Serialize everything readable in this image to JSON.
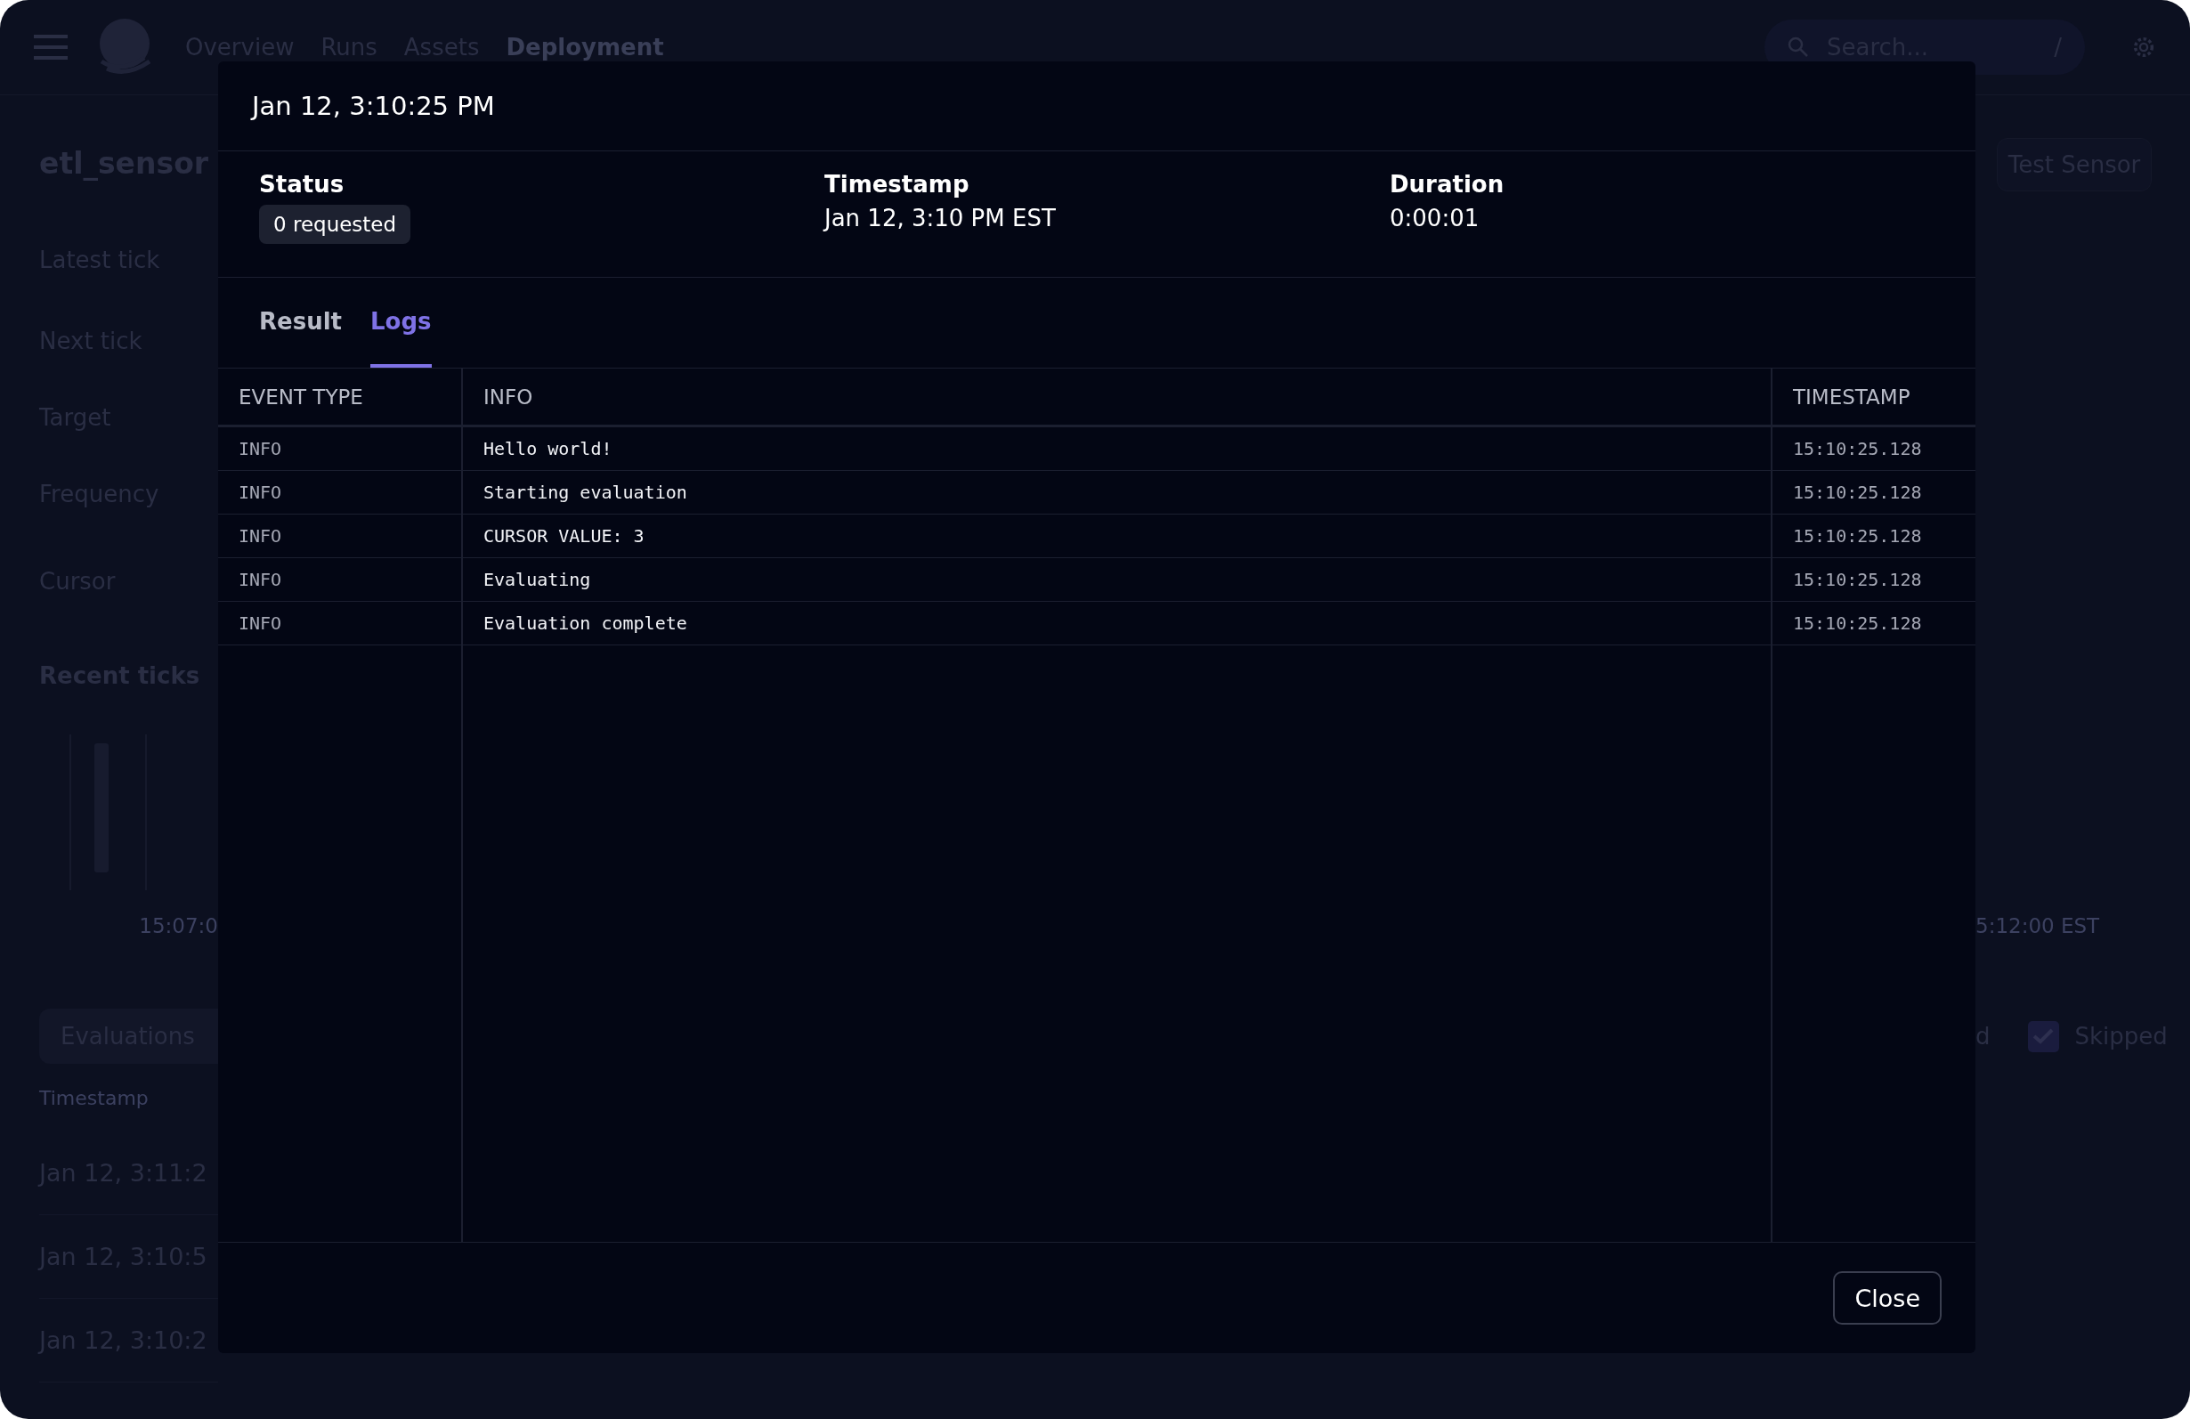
{
  "nav": {
    "links": [
      {
        "label": "Overview",
        "selected": false
      },
      {
        "label": "Runs",
        "selected": false
      },
      {
        "label": "Assets",
        "selected": false
      },
      {
        "label": "Deployment",
        "selected": true
      }
    ],
    "search": {
      "placeholder": "Search...",
      "shortcut": "/"
    }
  },
  "page": {
    "title": "etl_sensor",
    "test_button": "Test Sensor",
    "details": [
      "Latest tick",
      "Next tick",
      "Target",
      "Frequency",
      "Cursor"
    ],
    "recent_ticks": {
      "title": "Recent ticks",
      "axis_start": "15:07:0",
      "axis_end": "5:12:00 EST"
    },
    "tab": "Evaluations",
    "filter": {
      "partial_label": "d",
      "label": "Skipped",
      "checked": true
    },
    "table": {
      "column": "Timestamp",
      "rows": [
        "Jan 12, 3:11:2",
        "Jan 12, 3:10:5",
        "Jan 12, 3:10:2"
      ]
    }
  },
  "dialog": {
    "title": "Jan 12, 3:10:25 PM",
    "fields": [
      {
        "label": "Status",
        "kind": "badge",
        "value": "0 requested"
      },
      {
        "label": "Timestamp",
        "kind": "text",
        "value": "Jan 12, 3:10 PM EST"
      },
      {
        "label": "Duration",
        "kind": "text",
        "value": "0:00:01"
      }
    ],
    "tabs": [
      {
        "label": "Result",
        "selected": false
      },
      {
        "label": "Logs",
        "selected": true
      }
    ],
    "log_table": {
      "columns": [
        "EVENT TYPE",
        "INFO",
        "TIMESTAMP"
      ],
      "rows": [
        {
          "event_type": "INFO",
          "info": "Hello world!",
          "timestamp": "15:10:25.128"
        },
        {
          "event_type": "INFO",
          "info": "Starting evaluation",
          "timestamp": "15:10:25.128"
        },
        {
          "event_type": "INFO",
          "info": "CURSOR VALUE: 3",
          "timestamp": "15:10:25.128"
        },
        {
          "event_type": "INFO",
          "info": "Evaluating",
          "timestamp": "15:10:25.128"
        },
        {
          "event_type": "INFO",
          "info": "Evaluation complete",
          "timestamp": "15:10:25.128"
        }
      ]
    },
    "close_button": "Close"
  }
}
